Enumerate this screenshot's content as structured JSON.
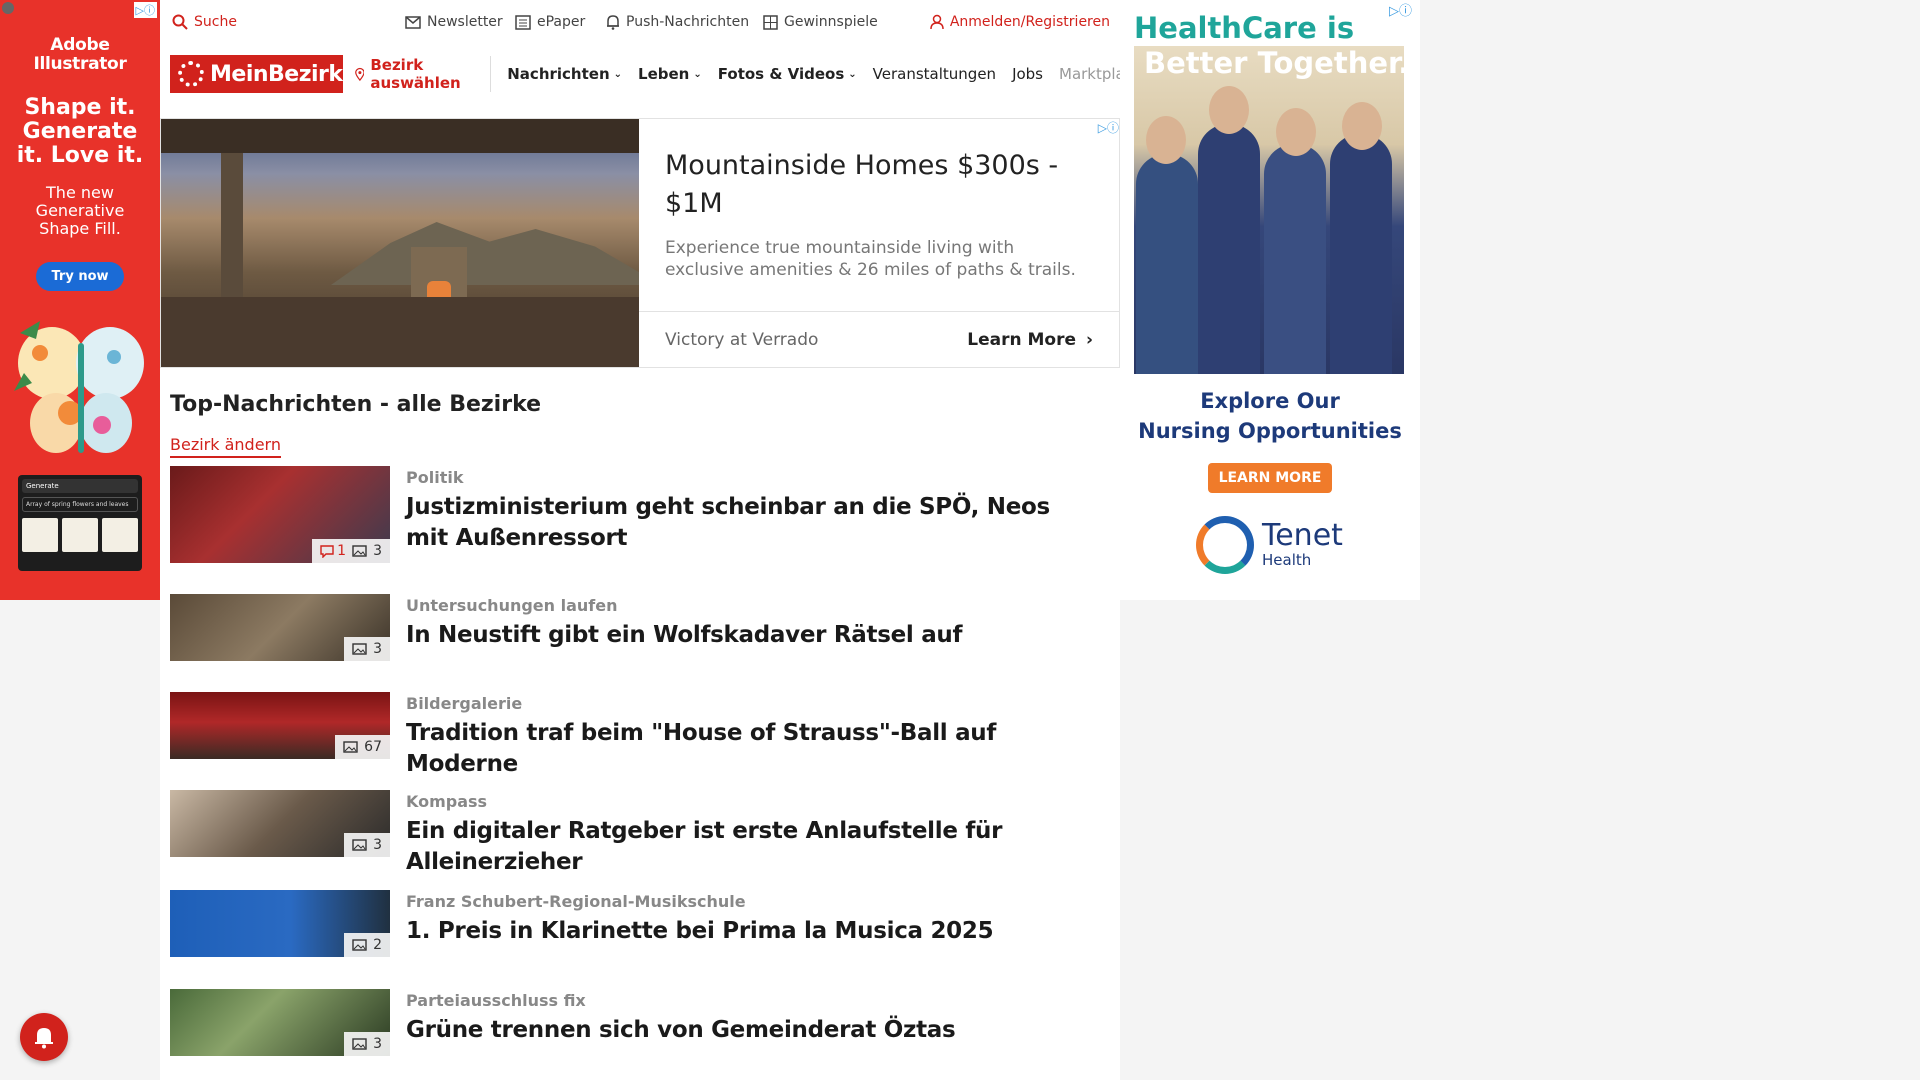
{
  "topbar": {
    "search": "Suche",
    "newsletter": "Newsletter",
    "epaper": "ePaper",
    "push": "Push-Nachrichten",
    "gewinnspiele": "Gewinnspiele",
    "login": "Anmelden/Registrieren"
  },
  "nav": {
    "logo": "MeinBezirk",
    "bezirk": "Bezirk auswählen",
    "items": [
      "Nachrichten",
      "Leben",
      "Fotos & Videos",
      "Veranstaltungen",
      "Jobs",
      "Marktplatz"
    ]
  },
  "left_ad": {
    "brand_line1": "Adobe",
    "brand_line2": "Illustrator",
    "headline": "Shape it. Generate it. Love it.",
    "sub": "The new Generative Shape Fill.",
    "cta": "Try now",
    "generate_label": "Generate",
    "prompt": "Array of spring flowers and leaves"
  },
  "native_ad": {
    "title": "Mountainside Homes $300s - $1M",
    "description": "Experience true mountainside living with exclusive amenities & 26 miles of paths & trails.",
    "brand": "Victory at Verrado",
    "cta": "Learn More"
  },
  "section": {
    "title": "Top-Nachrichten - alle Bezirke",
    "change": "Bezirk ändern"
  },
  "articles": [
    {
      "kicker": "Politik",
      "title": "Justizministerium geht scheinbar an die SPÖ, Neos mit Außenressort",
      "comments": "1",
      "photos": "3"
    },
    {
      "kicker": "Untersuchungen laufen",
      "title": "In Neustift gibt ein Wolfskadaver Rätsel auf",
      "comments": "",
      "photos": "3"
    },
    {
      "kicker": "Bildergalerie",
      "title": "Tradition traf beim \"House of Strauss\"-Ball auf Moderne",
      "comments": "",
      "photos": "67"
    },
    {
      "kicker": "Kompass",
      "title": "Ein digitaler Ratgeber ist erste Anlaufstelle für Alleinerzieher",
      "comments": "",
      "photos": "3"
    },
    {
      "kicker": "Franz Schubert-Regional-Musikschule",
      "title": "1. Preis in Klarinette bei Prima la Musica 2025",
      "comments": "",
      "photos": "2"
    },
    {
      "kicker": "Parteiausschluss fix",
      "title": "Grüne trennen sich von Gemeinderat Öztas",
      "comments": "",
      "photos": "3"
    }
  ],
  "right_ad": {
    "headline_top": "HealthCare is",
    "headline_bottom": "Better Together.",
    "explore_line1": "Explore Our",
    "explore_line2": "Nursing Opportunities",
    "cta": "LEARN MORE",
    "brand": "Tenet",
    "brand_sub": "Health"
  },
  "colors": {
    "brand_red": "#d1221c",
    "teal": "#1fa59a",
    "navy": "#1d3a7a",
    "orange": "#f07b2a"
  }
}
